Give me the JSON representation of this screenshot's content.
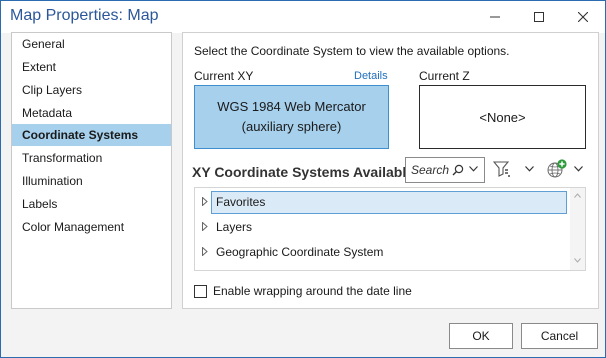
{
  "window": {
    "title": "Map Properties: Map",
    "controls": [
      "minimize-icon",
      "maximize-icon",
      "close-icon"
    ]
  },
  "nav": {
    "items": [
      {
        "label": "General",
        "selected": false
      },
      {
        "label": "Extent",
        "selected": false
      },
      {
        "label": "Clip Layers",
        "selected": false
      },
      {
        "label": "Metadata",
        "selected": false
      },
      {
        "label": "Coordinate Systems",
        "selected": true
      },
      {
        "label": "Transformation",
        "selected": false
      },
      {
        "label": "Illumination",
        "selected": false
      },
      {
        "label": "Labels",
        "selected": false
      },
      {
        "label": "Color Management",
        "selected": false
      }
    ]
  },
  "panel": {
    "instruction": "Select the Coordinate System to view the available options.",
    "current_xy_label": "Current XY",
    "details_link": "Details",
    "current_z_label": "Current Z",
    "current_xy_line1": "WGS 1984 Web Mercator",
    "current_xy_line2": "(auxiliary sphere)",
    "current_z_value": "<None>",
    "available_title": "XY Coordinate Systems Available",
    "search_placeholder": "Search",
    "tree": [
      "Favorites",
      "Layers",
      "Geographic Coordinate System"
    ],
    "wrap_label": "Enable wrapping around the date line",
    "wrap_checked": false
  },
  "buttons": {
    "ok": "OK",
    "cancel": "Cancel"
  },
  "colors": {
    "accent": "#2b579a",
    "selection": "#a6d0ec",
    "link": "#1f6fbf"
  }
}
